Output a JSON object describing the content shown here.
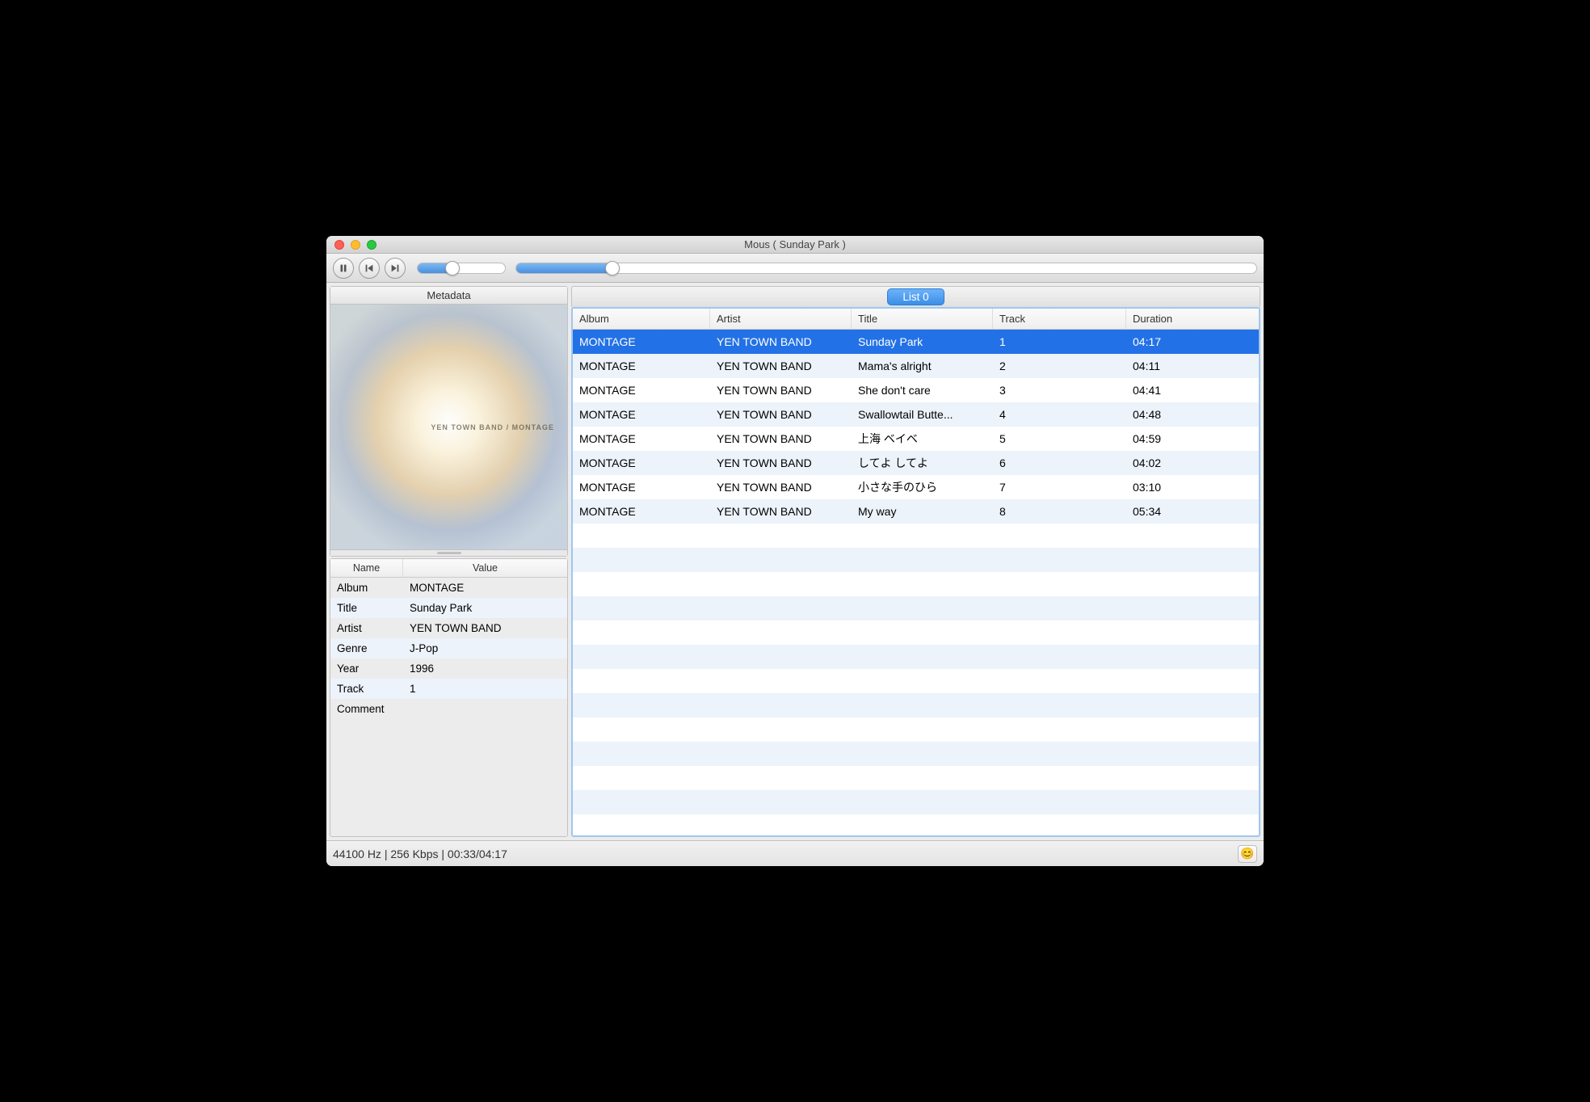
{
  "window": {
    "title": "Mous ( Sunday Park )"
  },
  "toolbar": {
    "volume_percent": 40,
    "progress_percent": 13
  },
  "sidebar": {
    "header": "Metadata",
    "album_art_text": "YEN TOWN BAND / MONTAGE",
    "columns": {
      "name": "Name",
      "value": "Value"
    },
    "rows": [
      {
        "name": "Album",
        "value": "MONTAGE"
      },
      {
        "name": "Title",
        "value": "Sunday Park"
      },
      {
        "name": "Artist",
        "value": "YEN TOWN BAND"
      },
      {
        "name": "Genre",
        "value": "J-Pop"
      },
      {
        "name": "Year",
        "value": "1996"
      },
      {
        "name": "Track",
        "value": "1"
      },
      {
        "name": "Comment",
        "value": ""
      }
    ]
  },
  "playlist": {
    "tab_label": "List 0",
    "columns": {
      "album": "Album",
      "artist": "Artist",
      "title": "Title",
      "track": "Track",
      "duration": "Duration"
    },
    "rows": [
      {
        "album": "MONTAGE",
        "artist": "YEN TOWN BAND",
        "title": "Sunday Park",
        "track": "1",
        "duration": "04:17",
        "selected": true
      },
      {
        "album": "MONTAGE",
        "artist": "YEN TOWN BAND",
        "title": "Mama's alright",
        "track": "2",
        "duration": "04:11"
      },
      {
        "album": "MONTAGE",
        "artist": "YEN TOWN BAND",
        "title": "She don't care",
        "track": "3",
        "duration": "04:41"
      },
      {
        "album": "MONTAGE",
        "artist": "YEN TOWN BAND",
        "title": "Swallowtail Butte...",
        "track": "4",
        "duration": "04:48"
      },
      {
        "album": "MONTAGE",
        "artist": "YEN TOWN BAND",
        "title": "上海 ベイベ",
        "track": "5",
        "duration": "04:59"
      },
      {
        "album": "MONTAGE",
        "artist": "YEN TOWN BAND",
        "title": "してよ してよ",
        "track": "6",
        "duration": "04:02"
      },
      {
        "album": "MONTAGE",
        "artist": "YEN TOWN BAND",
        "title": "小さな手のひら",
        "track": "7",
        "duration": "03:10"
      },
      {
        "album": "MONTAGE",
        "artist": "YEN TOWN BAND",
        "title": "My way",
        "track": "8",
        "duration": "05:34"
      }
    ]
  },
  "status": {
    "text": "44100 Hz  |  256 Kbps | 00:33/04:17",
    "emoji": "😊"
  }
}
